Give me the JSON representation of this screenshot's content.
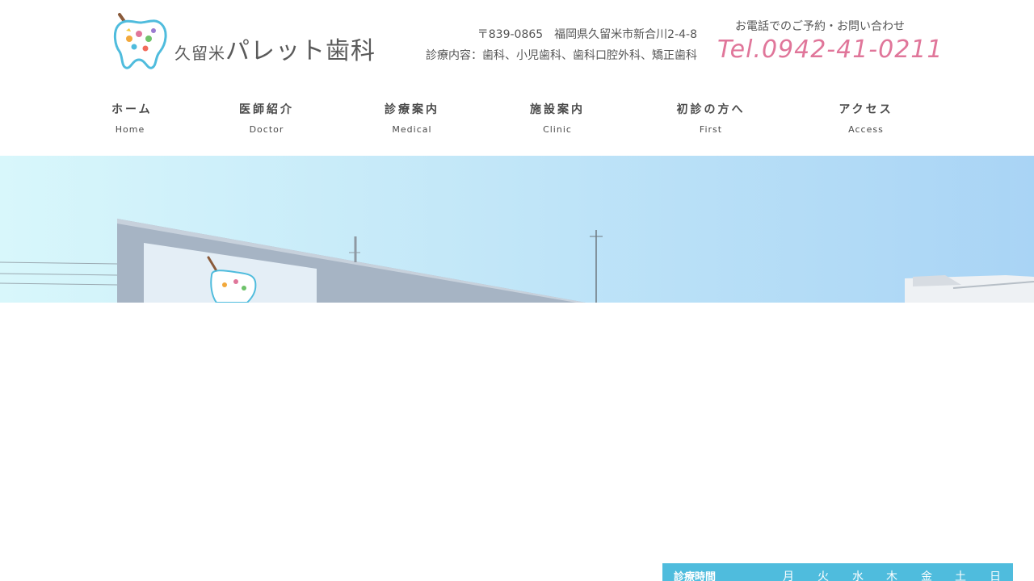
{
  "header": {
    "logo": {
      "prefix": "久留米",
      "name": "パレット歯科"
    },
    "address_line": "〒839-0865　福岡県久留米市新合川2-4-8",
    "services_line": "診療内容：歯科、小児歯科、歯科口腔外科、矯正歯科",
    "tel_label": "お電話でのご予約・お問い合わせ",
    "tel_number": "Tel.0942-41-0211"
  },
  "nav": {
    "items": [
      {
        "jp": "ホーム",
        "en": "Home"
      },
      {
        "jp": "医師紹介",
        "en": "Doctor"
      },
      {
        "jp": "診療案内",
        "en": "Medical"
      },
      {
        "jp": "施設案内",
        "en": "Clinic"
      },
      {
        "jp": "初診の方へ",
        "en": "First"
      },
      {
        "jp": "アクセス",
        "en": "Access"
      }
    ]
  },
  "hours": {
    "label": "診療時間",
    "days": [
      "月",
      "火",
      "水",
      "木",
      "金",
      "土",
      "日"
    ]
  },
  "colors": {
    "accent_pink": "#e0769a",
    "hours_bar": "#4fbcdd",
    "text": "#4a4a4a"
  }
}
